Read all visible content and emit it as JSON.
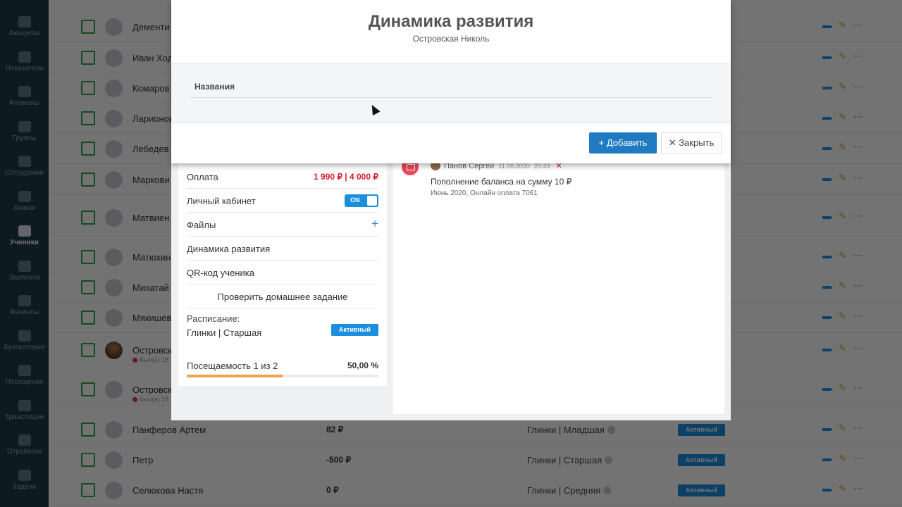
{
  "sidebar": {
    "items": [
      {
        "label": "Аккаунты",
        "icon": "account-icon"
      },
      {
        "label": "Показатели",
        "icon": "dashboard-icon"
      },
      {
        "label": "Филиалы",
        "icon": "bank-icon"
      },
      {
        "label": "Группы",
        "icon": "group-icon"
      },
      {
        "label": "Сотрудники",
        "icon": "staff-icon"
      },
      {
        "label": "Заявки",
        "icon": "request-icon"
      },
      {
        "label": "Ученики",
        "icon": "student-icon",
        "active": true
      },
      {
        "label": "Зарплата",
        "icon": "salary-icon"
      },
      {
        "label": "Финансы",
        "icon": "finance-icon"
      },
      {
        "label": "Бухгалтерия",
        "icon": "accounting-icon"
      },
      {
        "label": "Посещения",
        "icon": "calendar-icon"
      },
      {
        "label": "Трансляции",
        "icon": "video-icon"
      },
      {
        "label": "Отработки",
        "icon": "save-icon"
      },
      {
        "label": "Задачи",
        "icon": "briefcase-icon"
      }
    ]
  },
  "list": {
    "rows": [
      {
        "name": "Дементи",
        "sub": "",
        "balance": "",
        "group": "",
        "badge": ""
      },
      {
        "name": "Иван Ход",
        "sub": "",
        "balance": "",
        "group": "",
        "badge": ""
      },
      {
        "name": "Комаров",
        "sub": "",
        "balance": "",
        "group": "",
        "badge": ""
      },
      {
        "name": "Ларионов",
        "sub": "",
        "balance": "",
        "group": "",
        "badge": ""
      },
      {
        "name": "Лебедев Е",
        "sub": "",
        "balance": "",
        "group": "",
        "badge": ""
      },
      {
        "name": "Маркови",
        "sub": "",
        "balance": "",
        "group": "",
        "badge": ""
      },
      {
        "name": "Матвиен",
        "sub": "",
        "balance": "",
        "group": "",
        "badge": ""
      },
      {
        "name": "Матюхин",
        "sub": "",
        "balance": "",
        "group": "",
        "badge": ""
      },
      {
        "name": "Михатай",
        "sub": "",
        "balance": "",
        "group": "",
        "badge": ""
      },
      {
        "name": "Мякишев",
        "sub": "",
        "balance": "",
        "group": "",
        "badge": ""
      },
      {
        "name": "Островск",
        "sub": "Был(а) 18",
        "balance": "",
        "group": "",
        "badge": "",
        "photo": true
      },
      {
        "name": "Островск",
        "sub": "Был(а) 18",
        "balance": "",
        "group": "",
        "badge": ""
      },
      {
        "name": "Панферов Артем",
        "sub": "",
        "balance": "82 ₽",
        "group": "Глинки | Младшая",
        "badge": "Активный"
      },
      {
        "name": "Петр",
        "sub": "",
        "balance": "-500 ₽",
        "group": "Глинки | Старшая",
        "badge": "Активный"
      },
      {
        "name": "Селюкова Настя",
        "sub": "",
        "balance": "0 ₽",
        "group": "Глинки | Средняя",
        "badge": "Активный"
      }
    ],
    "icons": {
      "calendar": "▬",
      "edit": "✎",
      "more": "⋯"
    }
  },
  "detail": {
    "payment": {
      "label": "Оплата",
      "value": "1 990 ₽ | 4 000 ₽"
    },
    "cabinet": {
      "label": "Личный кабинет",
      "toggle": "ON"
    },
    "files": {
      "label": "Файлы",
      "add": "+"
    },
    "dynamics": {
      "label": "Динамика развития"
    },
    "qr": {
      "label": "QR-код ученика"
    },
    "homework": {
      "label": "Проверить домашнее задание"
    },
    "schedule": {
      "label": "Расписание:",
      "value": "Глинки | Старшая",
      "badge": "Активный"
    },
    "attendance": {
      "label": "Посещаемость 1 из 2",
      "value": "50,00 %",
      "fraction": 0.5
    }
  },
  "transaction": {
    "author": "Панов Сергей",
    "date": "11.06.2020",
    "time": "20:49",
    "delete": "✕",
    "title": "Пополнение баланса на сумму 10 ₽",
    "subtitle": "Июнь 2020, Онлайн оплата 7061"
  },
  "modal": {
    "title": "Динамика развития",
    "subtitle": "Островская Николь",
    "column": "Названия",
    "add_label": "+ Добавить",
    "close_label": "✕ Закрыть"
  }
}
